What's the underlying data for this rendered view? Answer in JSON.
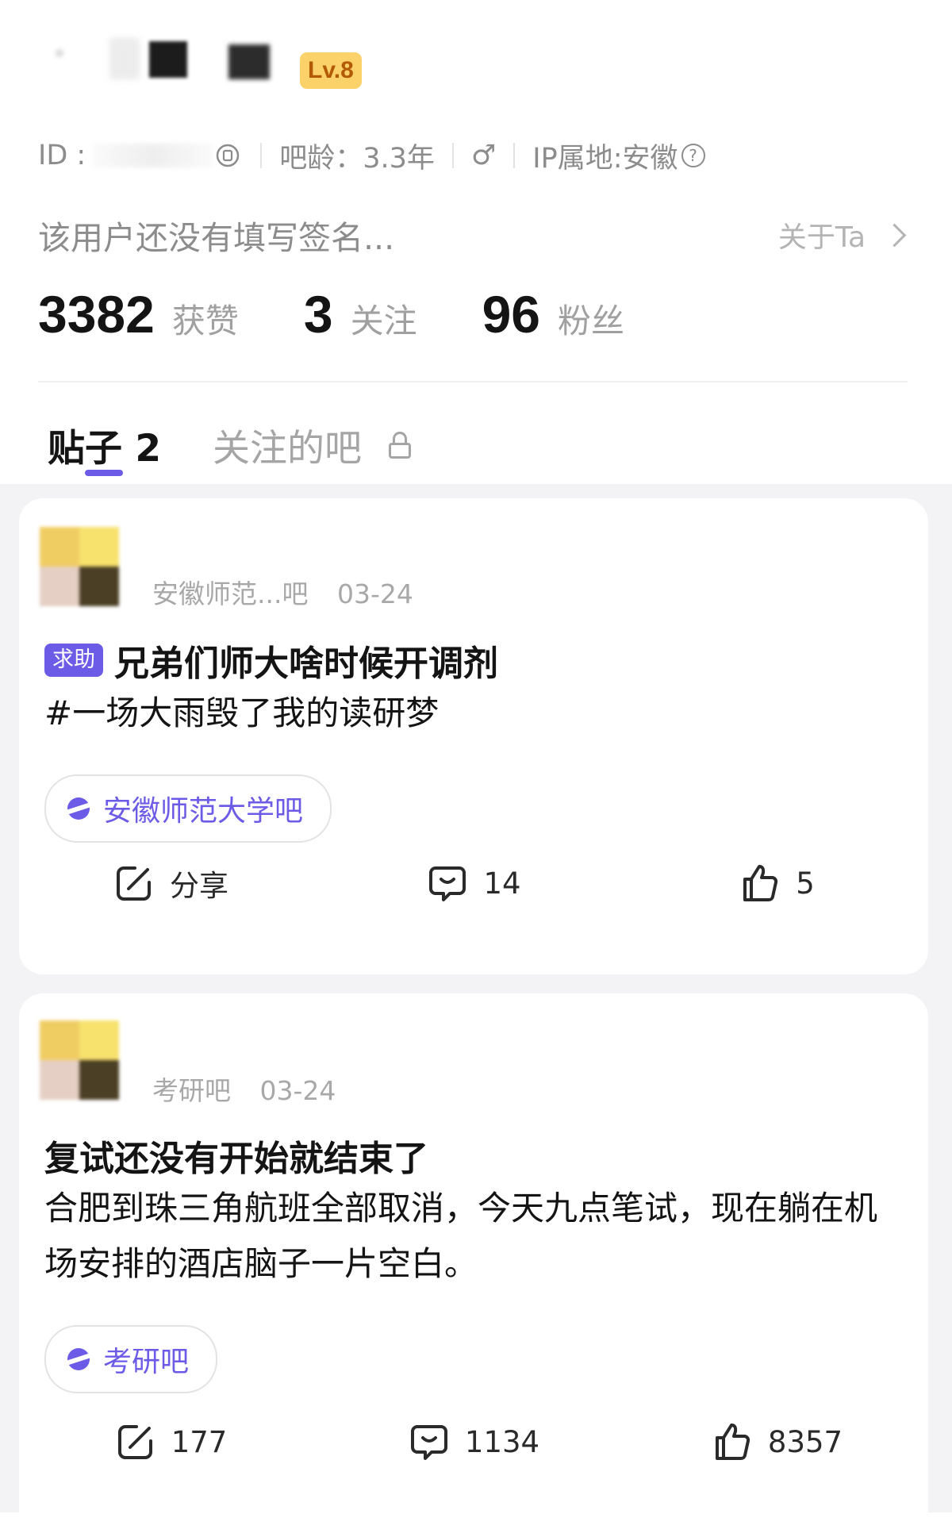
{
  "profile": {
    "level": "Lv.8",
    "id_label": "ID :",
    "bar_age": "吧龄：3.3年",
    "gender_symbol": "♂",
    "ip_location": "IP属地:安徽",
    "ip_help_icon": "?",
    "signature": "该用户还没有填写签名...",
    "about_link": "关于Ta"
  },
  "stats": [
    {
      "value": "3382",
      "label": "获赞"
    },
    {
      "value": "3",
      "label": "关注"
    },
    {
      "value": "96",
      "label": "粉丝"
    }
  ],
  "tabs": {
    "posts": "贴子 2",
    "followed_bars": "关注的吧"
  },
  "posts": [
    {
      "bar_name": "安徽师范...吧",
      "date": "03-24",
      "tag": "求助",
      "title": "兄弟们师大啥时候开调剂",
      "body": "#一场大雨毁了我的读研梦",
      "bar_chip": "安徽师范大学吧",
      "share_label": "分享",
      "comments": "14",
      "likes": "5"
    },
    {
      "bar_name": "考研吧",
      "date": "03-24",
      "title": "复试还没有开始就结束了",
      "body": "合肥到珠三角航班全部取消，今天九点笔试，现在躺在机场安排的酒店脑子一片空白。",
      "bar_chip": "考研吧",
      "share_label": "177",
      "comments": "1134",
      "likes": "8357"
    }
  ],
  "colors": {
    "accent": "#6b5be6",
    "level_badge_bg": "#fbd16a",
    "level_badge_text": "#b25a05",
    "feed_bg": "#f3f3f5",
    "muted_text": "#8c8c8c"
  }
}
